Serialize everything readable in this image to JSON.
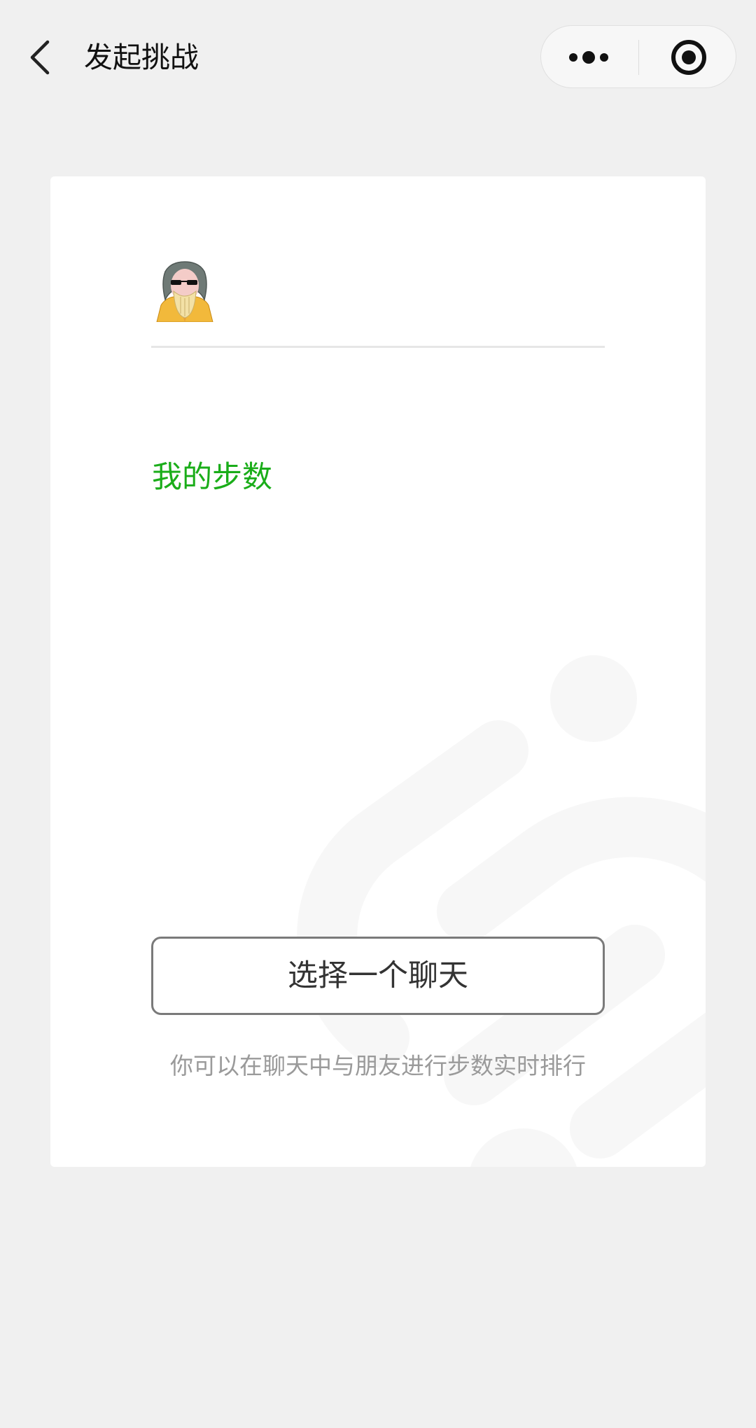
{
  "nav": {
    "title": "发起挑战",
    "back_icon": "chevron-left-icon",
    "more_icon": "more-dots-icon",
    "close_icon": "target-close-icon"
  },
  "card": {
    "avatar_icon": "avatar-cartoon-old-man-sunglasses",
    "my_steps_label": "我的步数",
    "select_chat_button": "选择一个聊天",
    "hint": "你可以在聊天中与朋友进行步数实时排行"
  },
  "colors": {
    "page_background": "#f0f0f0",
    "card_background": "#ffffff",
    "accent_green": "#1aad19",
    "hint_gray": "#9a9a9a"
  }
}
